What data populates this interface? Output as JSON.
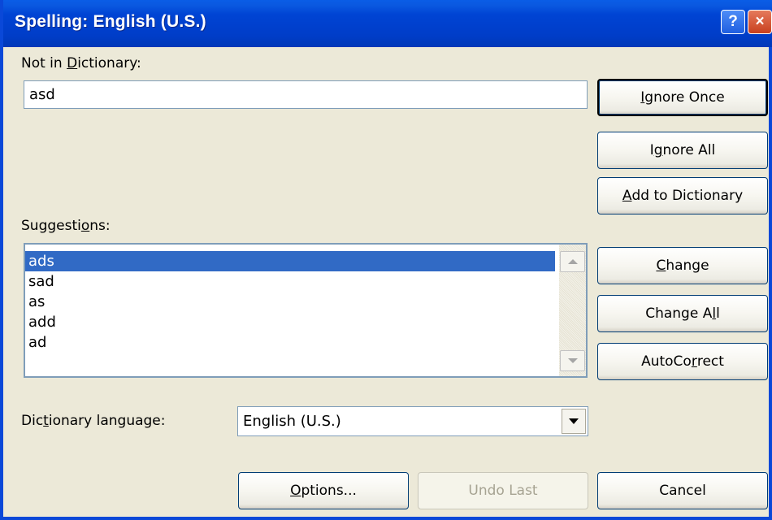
{
  "window": {
    "title": "Spelling: English (U.S.)",
    "help_glyph": "?",
    "close_glyph": "×"
  },
  "not_in_dictionary": {
    "label_before": "Not in ",
    "label_key": "D",
    "label_after": "ictionary:",
    "value": "asd"
  },
  "suggestions": {
    "label_before": "Suggesti",
    "label_key": "o",
    "label_after": "ns:",
    "items": [
      "ads",
      "sad",
      "as",
      "add",
      "ad"
    ],
    "selected_index": 0
  },
  "dictionary_language": {
    "label_before": "Dic",
    "label_key": "t",
    "label_after": "ionary language:",
    "value": "English (U.S.)"
  },
  "buttons": {
    "ignore_once": {
      "before": "",
      "key": "I",
      "after": "gnore Once"
    },
    "ignore_all": {
      "before": "I",
      "key": "g",
      "after": "nore All"
    },
    "add_to_dictionary": {
      "before": "",
      "key": "A",
      "after": "dd to Dictionary"
    },
    "change": {
      "before": "",
      "key": "C",
      "after": "hange"
    },
    "change_all": {
      "before": "Change A",
      "key": "l",
      "after": "l"
    },
    "autocorrect": {
      "before": "AutoCo",
      "key": "r",
      "after": "rect"
    },
    "options": {
      "before": "",
      "key": "O",
      "after": "ptions..."
    },
    "undo_last": "Undo Last",
    "cancel": "Cancel"
  },
  "colors": {
    "title_bar": "#0044d4",
    "selection": "#316ac5",
    "dialog_bg": "#ece9d8"
  }
}
